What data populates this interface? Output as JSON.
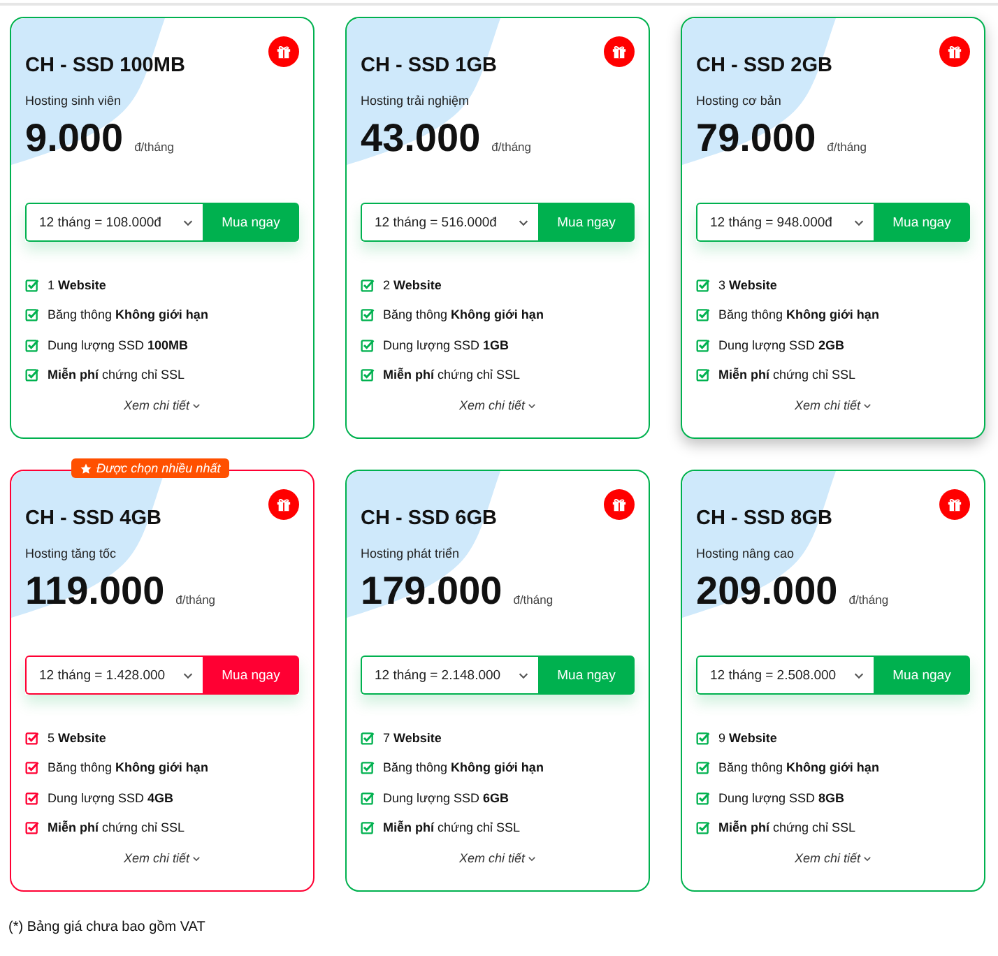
{
  "plans": [
    {
      "name": "CH - SSD 100MB",
      "subtitle": "Hosting sinh viên",
      "price": "9.000",
      "unit": "đ/tháng",
      "term": "12 tháng = 108.000đ",
      "buy": "Mua ngay",
      "features": [
        "1 **Website**",
        "Băng thông **Không giới hạn**",
        "Dung lượng SSD **100MB**",
        "**Miễn phí** chứng chỉ SSL"
      ],
      "details": "Xem chi tiết",
      "featured": false,
      "hovered": false
    },
    {
      "name": "CH - SSD 1GB",
      "subtitle": "Hosting trải nghiệm",
      "price": "43.000",
      "unit": "đ/tháng",
      "term": "12 tháng = 516.000đ",
      "buy": "Mua ngay",
      "features": [
        "2 **Website**",
        "Băng thông **Không giới hạn**",
        "Dung lượng SSD **1GB**",
        "**Miễn phí** chứng chỉ SSL"
      ],
      "details": "Xem chi tiết",
      "featured": false,
      "hovered": false
    },
    {
      "name": "CH - SSD 2GB",
      "subtitle": "Hosting cơ bản",
      "price": "79.000",
      "unit": "đ/tháng",
      "term": "12 tháng = 948.000đ",
      "buy": "Mua ngay",
      "features": [
        "3 **Website**",
        "Băng thông **Không giới hạn**",
        "Dung lượng SSD **2GB**",
        "**Miễn phí** chứng chỉ SSL"
      ],
      "details": "Xem chi tiết",
      "featured": false,
      "hovered": true
    },
    {
      "name": "CH - SSD 4GB",
      "subtitle": "Hosting tăng tốc",
      "price": "119.000",
      "unit": "đ/tháng",
      "term": "12 tháng = 1.428.000",
      "buy": "Mua ngay",
      "features": [
        "5 **Website**",
        "Băng thông **Không giới hạn**",
        "Dung lượng SSD **4GB**",
        "**Miễn phí** chứng chỉ SSL"
      ],
      "details": "Xem chi tiết",
      "featured": true,
      "badge": "Được chọn nhiều nhất",
      "hovered": false
    },
    {
      "name": "CH - SSD 6GB",
      "subtitle": "Hosting phát triển",
      "price": "179.000",
      "unit": "đ/tháng",
      "term": "12 tháng = 2.148.000",
      "buy": "Mua ngay",
      "features": [
        "7 **Website**",
        "Băng thông **Không giới hạn**",
        "Dung lượng SSD **6GB**",
        "**Miễn phí** chứng chỉ SSL"
      ],
      "details": "Xem chi tiết",
      "featured": false,
      "hovered": false
    },
    {
      "name": "CH - SSD 8GB",
      "subtitle": "Hosting nâng cao",
      "price": "209.000",
      "unit": "đ/tháng",
      "term": "12 tháng = 2.508.000",
      "buy": "Mua ngay",
      "features": [
        "9 **Website**",
        "Băng thông **Không giới hạn**",
        "Dung lượng SSD **8GB**",
        "**Miễn phí** chứng chỉ SSL"
      ],
      "details": "Xem chi tiết",
      "featured": false,
      "hovered": false
    }
  ],
  "note": "(*) Bảng giá chưa bao gồm VAT"
}
